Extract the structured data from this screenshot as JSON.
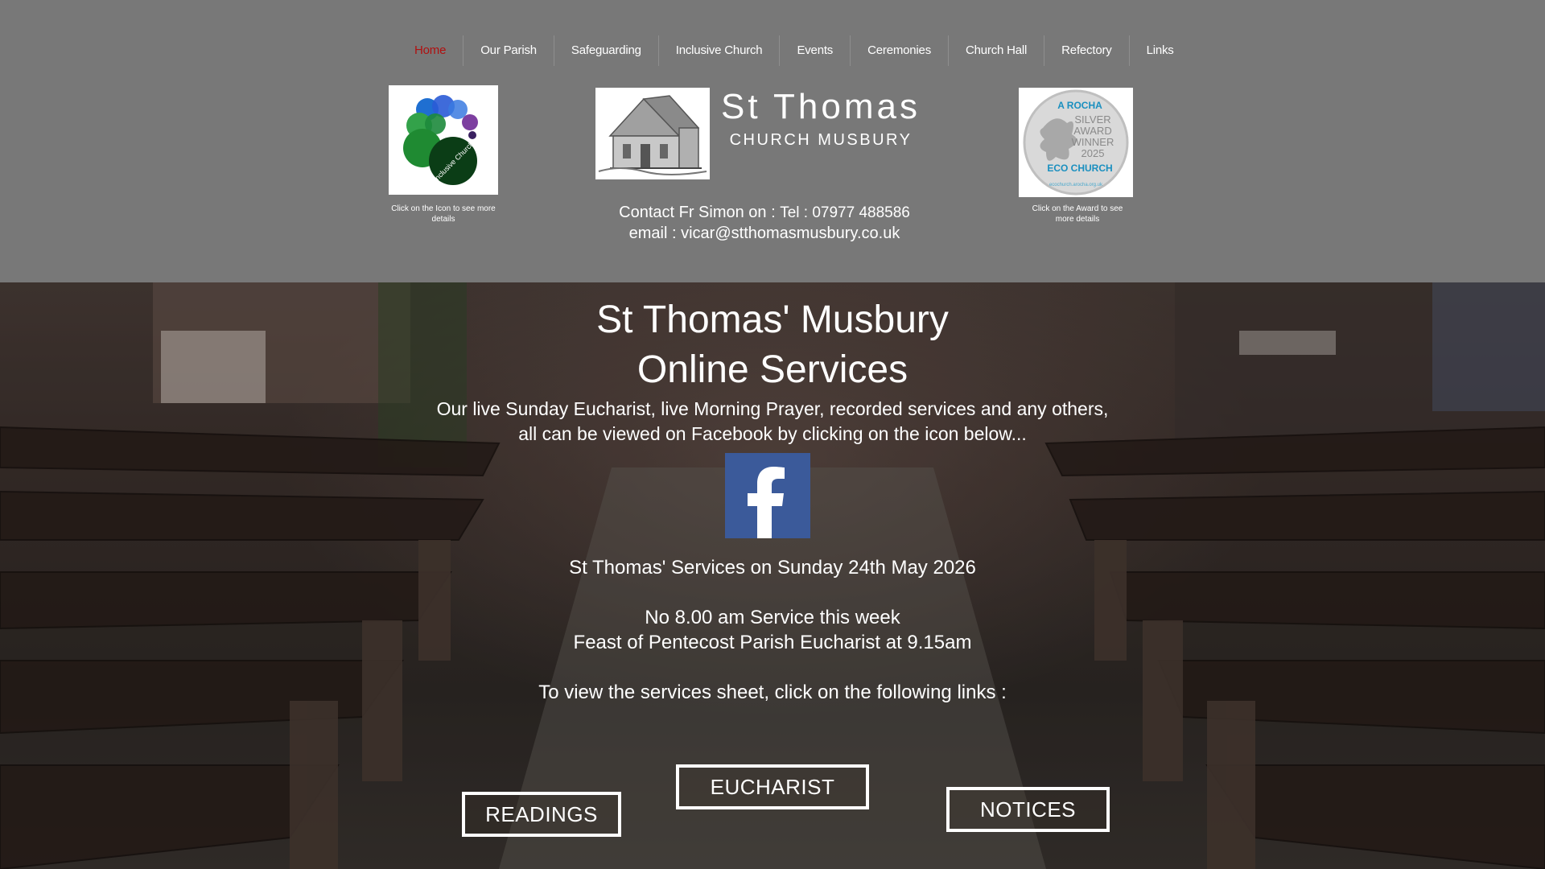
{
  "nav": {
    "items": [
      {
        "label": "Home",
        "active": true
      },
      {
        "label": "Our Parish"
      },
      {
        "label": "Safeguarding"
      },
      {
        "label": "Inclusive Church"
      },
      {
        "label": "Events"
      },
      {
        "label": "Ceremonies"
      },
      {
        "label": "Church Hall"
      },
      {
        "label": "Refectory"
      },
      {
        "label": "Links"
      }
    ]
  },
  "header": {
    "inclusive_logo_text": "Inclusive Church",
    "inclusive_caption": "Click on the Icon to see more details",
    "title": "St Thomas",
    "subtitle": "CHURCH MUSBURY",
    "award_lines": [
      "A ROCHA",
      "SILVER",
      "AWARD",
      "WINNER",
      "2025",
      "ECO CHURCH"
    ],
    "award_url_text": "ecochurch.arocha.org.uk",
    "award_caption": "Click on the Award to see more details",
    "contact_label": "Contact Fr Simon on : ",
    "contact_tel": "Tel : 07977 488586",
    "contact_email": "email : vicar@stthomasmusbury.co.uk"
  },
  "hero": {
    "title_line1": "St Thomas' Musbury",
    "title_line2": "Online Services",
    "desc_line1": "Our live Sunday Eucharist, live Morning Prayer, recorded services and any others,",
    "desc_line2": "all can be viewed on Facebook by clicking on the icon below...",
    "services_heading": "St Thomas' Services on Sunday 24th May 2026",
    "service_line1": "No 8.00 am Service this week",
    "service_line2": "Feast of Pentecost Parish Eucharist at 9.15am",
    "links_text": "To view the services sheet, click on the following links :",
    "buttons": {
      "readings": "READINGS",
      "eucharist": "EUCHARIST",
      "notices": "NOTICES"
    }
  },
  "colors": {
    "header_bg": "#787878",
    "nav_active": "#b01010",
    "facebook_blue": "#3b5a9a"
  }
}
